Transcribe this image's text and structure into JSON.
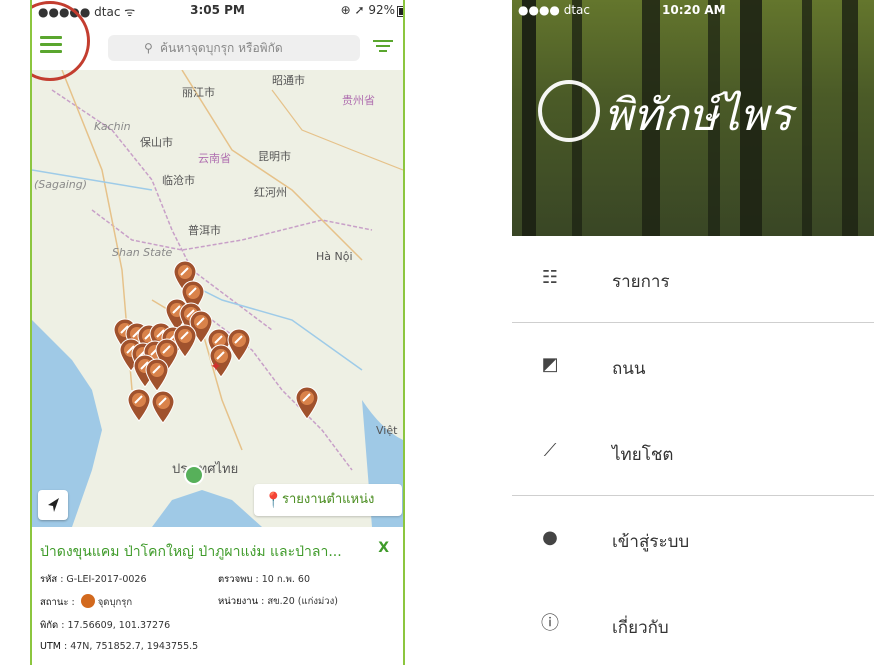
{
  "left_screen": {
    "status": {
      "carrier": "●●●●● dtac ᯤ",
      "time": "3:05 PM",
      "battery": "⊕ ➚ 92%"
    },
    "search": {
      "placeholder": "ค้นหาจุดบุกรุก หรือพิกัด"
    },
    "map_labels": [
      {
        "text": "昭通市",
        "cls": ""
      },
      {
        "text": "丽江市",
        "cls": ""
      },
      {
        "text": "Kachin",
        "cls": "it"
      },
      {
        "text": "贵州省",
        "cls": ""
      },
      {
        "text": "保山市",
        "cls": ""
      },
      {
        "text": "云南省",
        "cls": ""
      },
      {
        "text": "昆明市",
        "cls": ""
      },
      {
        "text": "(Sagaing)",
        "cls": "it"
      },
      {
        "text": "临沧市",
        "cls": ""
      },
      {
        "text": "红河州",
        "cls": ""
      },
      {
        "text": "普洱市",
        "cls": ""
      },
      {
        "text": "Shan State",
        "cls": "it"
      },
      {
        "text": "Hà Nội",
        "cls": ""
      },
      {
        "text": "ประเทศไทย",
        "cls": ""
      },
      {
        "text": "Việt",
        "cls": ""
      }
    ],
    "report_button": "รายงานตำแหน่ง",
    "info": {
      "title": "ป่าดงขุนแคม ป่าโคกใหญ่ ป่าภูผาแง่ม และป่าลา...",
      "close": "X",
      "code_label": "รหัส",
      "code_value": "G-LEI-2017-0026",
      "found_label": "ตรวจพบ",
      "found_value": "10 ก.พ. 60",
      "status_label": "สถานะ",
      "status_value": "จุดบุกรุก",
      "unit_label": "หน่วยงาน",
      "unit_value": "สข.20 (แก่งม่วง)",
      "coord_label": "พิกัด",
      "coord_value": "17.56609, 101.37276",
      "utm_label": "UTM",
      "utm_value": "47N, 751852.7, 1943755.5"
    },
    "colors": {
      "accent": "#3f9b2a",
      "pin": "#a0522d",
      "highlight_circle": "#c33d2f"
    }
  },
  "right_screen": {
    "status": {
      "carrier": "●●●● dtac",
      "time": "10:20 AM"
    },
    "logo_text": "พิทักษ์ไพร",
    "menu": [
      {
        "icon": "list-icon",
        "label": "รายการ"
      },
      {
        "icon": "map-icon",
        "label": "ถนน"
      },
      {
        "icon": "satellite-icon",
        "label": "ไทยโชต"
      },
      {
        "icon": "user-icon",
        "label": "เข้าสู่ระบบ"
      },
      {
        "icon": "info-icon",
        "label": "เกี่ยวกับ"
      }
    ]
  }
}
